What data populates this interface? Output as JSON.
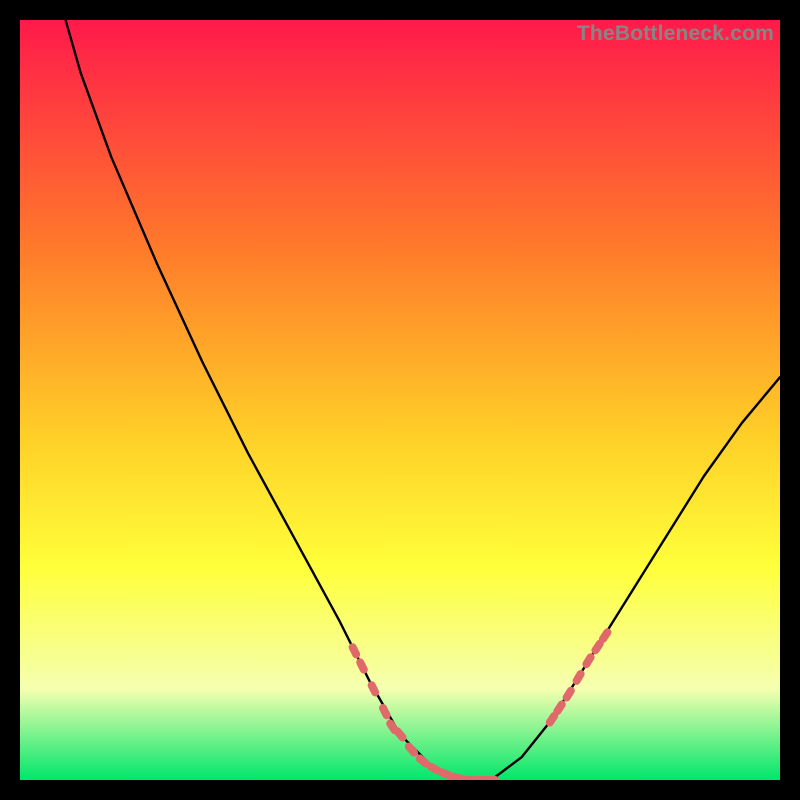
{
  "watermark": "TheBottleneck.com",
  "colors": {
    "background_black": "#000000",
    "gradient_top": "#ff1a4b",
    "gradient_mid1": "#ff7a2a",
    "gradient_mid2": "#ffd028",
    "gradient_mid3": "#ffff3a",
    "gradient_mid4": "#f5ffb0",
    "gradient_bottom": "#00e66b",
    "curve": "#000000",
    "marker": "#e06a6a"
  },
  "chart_data": {
    "type": "line",
    "title": "",
    "xlabel": "",
    "ylabel": "",
    "xlim": [
      0,
      100
    ],
    "ylim": [
      0,
      100
    ],
    "grid": false,
    "curve": [
      {
        "x": 6,
        "y": 100
      },
      {
        "x": 8,
        "y": 93
      },
      {
        "x": 12,
        "y": 82
      },
      {
        "x": 18,
        "y": 68
      },
      {
        "x": 24,
        "y": 55
      },
      {
        "x": 30,
        "y": 43
      },
      {
        "x": 36,
        "y": 32
      },
      {
        "x": 42,
        "y": 21
      },
      {
        "x": 46,
        "y": 13
      },
      {
        "x": 50,
        "y": 6
      },
      {
        "x": 54,
        "y": 2
      },
      {
        "x": 58,
        "y": 0
      },
      {
        "x": 62,
        "y": 0
      },
      {
        "x": 66,
        "y": 3
      },
      {
        "x": 70,
        "y": 8
      },
      {
        "x": 75,
        "y": 16
      },
      {
        "x": 80,
        "y": 24
      },
      {
        "x": 85,
        "y": 32
      },
      {
        "x": 90,
        "y": 40
      },
      {
        "x": 95,
        "y": 47
      },
      {
        "x": 100,
        "y": 53
      }
    ],
    "markers_left": [
      {
        "x": 44,
        "y": 17
      },
      {
        "x": 45,
        "y": 15
      },
      {
        "x": 46.5,
        "y": 12
      },
      {
        "x": 48,
        "y": 9
      },
      {
        "x": 49,
        "y": 7
      },
      {
        "x": 50,
        "y": 6
      },
      {
        "x": 51.5,
        "y": 4
      },
      {
        "x": 53,
        "y": 2.5
      },
      {
        "x": 54.5,
        "y": 1.5
      },
      {
        "x": 56,
        "y": 0.8
      },
      {
        "x": 57.5,
        "y": 0.3
      },
      {
        "x": 59,
        "y": 0
      },
      {
        "x": 60.5,
        "y": 0
      },
      {
        "x": 62,
        "y": 0
      }
    ],
    "markers_right": [
      {
        "x": 70,
        "y": 8
      },
      {
        "x": 71,
        "y": 9.5
      },
      {
        "x": 72.2,
        "y": 11.3
      },
      {
        "x": 73.5,
        "y": 13.5
      },
      {
        "x": 74.8,
        "y": 15.7
      },
      {
        "x": 76,
        "y": 17.5
      },
      {
        "x": 77,
        "y": 19
      }
    ]
  }
}
